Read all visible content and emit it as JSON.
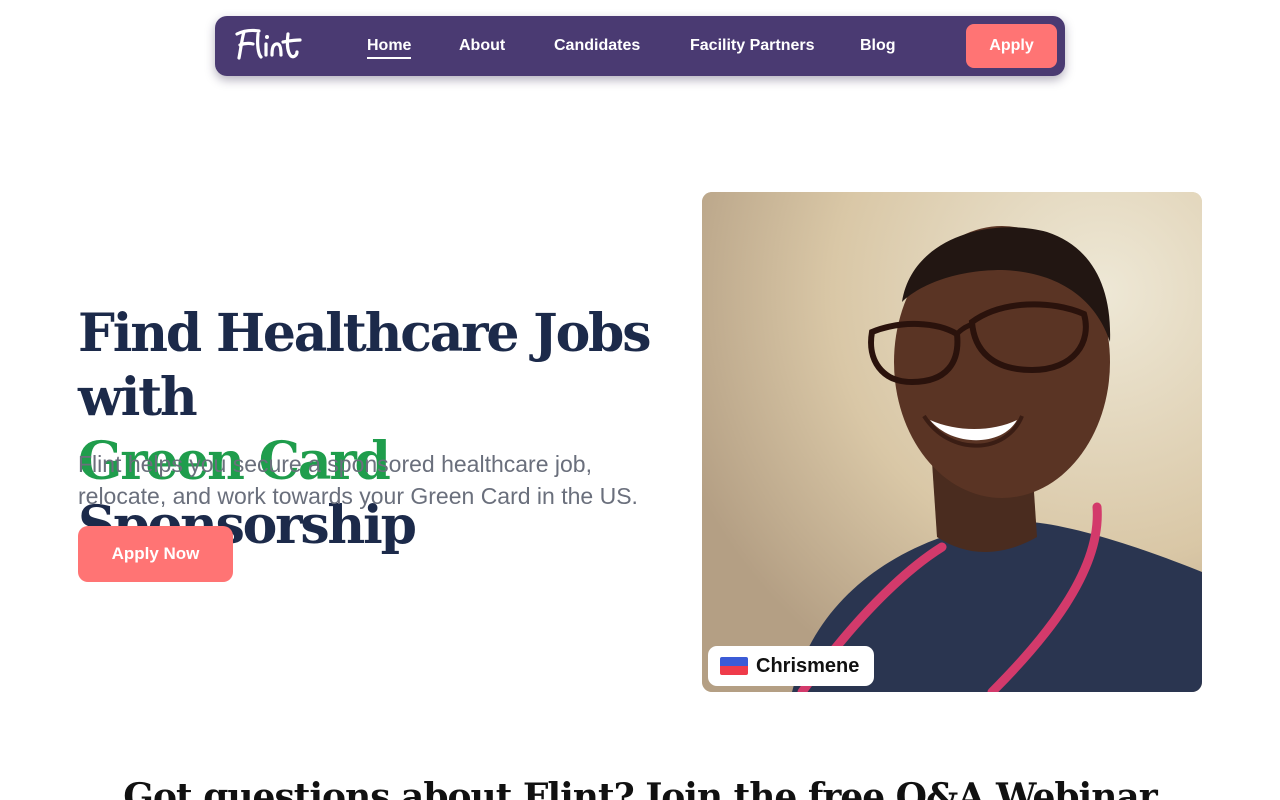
{
  "nav": {
    "logo_text": "Flint",
    "links": [
      {
        "label": "Home"
      },
      {
        "label": "About"
      },
      {
        "label": "Candidates"
      },
      {
        "label": "Facility Partners"
      },
      {
        "label": "Blog"
      }
    ],
    "apply_label": "Apply"
  },
  "hero": {
    "title_line1": "Find Healthcare Jobs with",
    "title_highlight": "Green Card",
    "title_rest": "Sponsorship",
    "subtitle": "Flint helps you secure a sponsored healthcare job, relocate, and work towards your Green Card in the US.",
    "cta_label": "Apply Now",
    "photo": {
      "person_name": "Chrismene",
      "flag_icon": "haiti-flag-icon"
    }
  },
  "webinar": {
    "heading": "Got questions about Flint? Join the free Q&A Webinar"
  },
  "colors": {
    "nav_bg": "#4a3a72",
    "accent_coral": "#ff7474",
    "heading_navy": "#1c2a4a",
    "highlight_green": "#1f9d4c"
  }
}
